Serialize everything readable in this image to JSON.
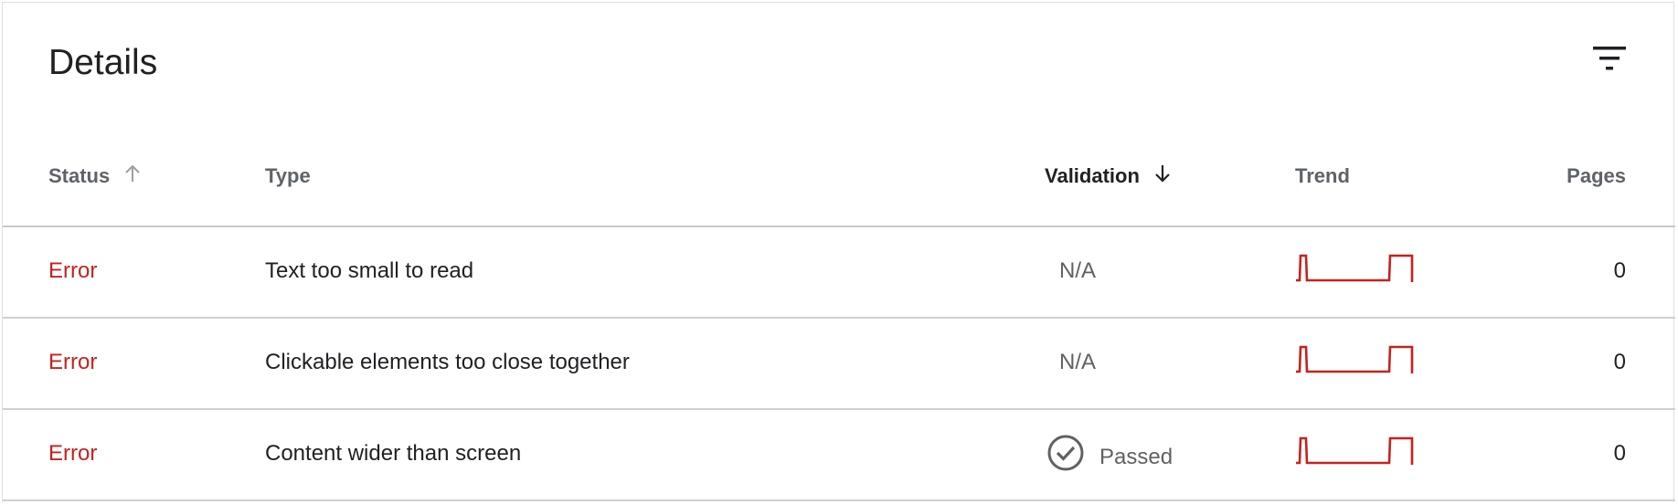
{
  "header": {
    "title": "Details"
  },
  "toolbar": {
    "filter_icon": "filter-list-icon"
  },
  "columns": {
    "status": "Status",
    "type": "Type",
    "validation": "Validation",
    "trend": "Trend",
    "pages": "Pages"
  },
  "sort": {
    "status_icon": "arrow-up-icon",
    "validation_icon": "arrow-down-icon",
    "active_column": "Validation"
  },
  "colors": {
    "error": "#c5221f",
    "trend_line": "#c5221f",
    "muted": "#616161"
  },
  "rows": [
    {
      "status": "Error",
      "type": "Text too small to read",
      "validation": "N/A",
      "validation_icon": "",
      "pages": "0"
    },
    {
      "status": "Error",
      "type": "Clickable elements too close together",
      "validation": "N/A",
      "validation_icon": "",
      "pages": "0"
    },
    {
      "status": "Error",
      "type": "Content wider than screen",
      "validation": "Passed",
      "validation_icon": "check-circle-icon",
      "pages": "0"
    }
  ]
}
